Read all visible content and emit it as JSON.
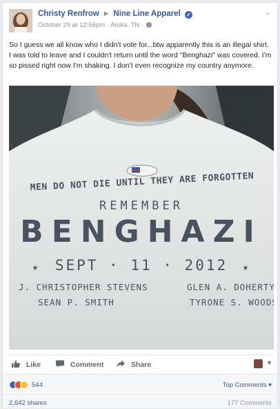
{
  "post": {
    "author": "Christy Renfrow",
    "page": "Nine Line Apparel",
    "date": "October 29 at 12:56pm",
    "location": "Atoka, TN",
    "text": "So I guess we all know who I didn't vote for...btw apparently this is an illegal shirt. I was told to leave and I couldn't return until the word \"Benghazi\" was covered. I'm so pissed right now I'm shaking. I don't even recognize my country anymore."
  },
  "photo": {
    "sticker": "I Voted",
    "shirt_line1": "MEN DO NOT DIE UNTIL THEY ARE FORGOTTEN",
    "shirt_remember": "REMEMBER",
    "shirt_word": "BENGHAZI",
    "shirt_date": "SEPT · 11 · 2012",
    "names": [
      "J. CHRISTOPHER STEVENS",
      "GLEN A. DOHERTY",
      "SEAN P. SMITH",
      "TYRONE S. WOODS"
    ]
  },
  "actions": {
    "like": "Like",
    "comment": "Comment",
    "share": "Share"
  },
  "reactions": {
    "count": "544",
    "top_comments": "Top Comments"
  },
  "footer": {
    "shares": "2,642 shares",
    "comments": "177 Comments"
  },
  "colors": {
    "link": "#365899",
    "muted": "#90949c",
    "background": "#e9ebee",
    "shirt_ink": "#4a5262"
  }
}
